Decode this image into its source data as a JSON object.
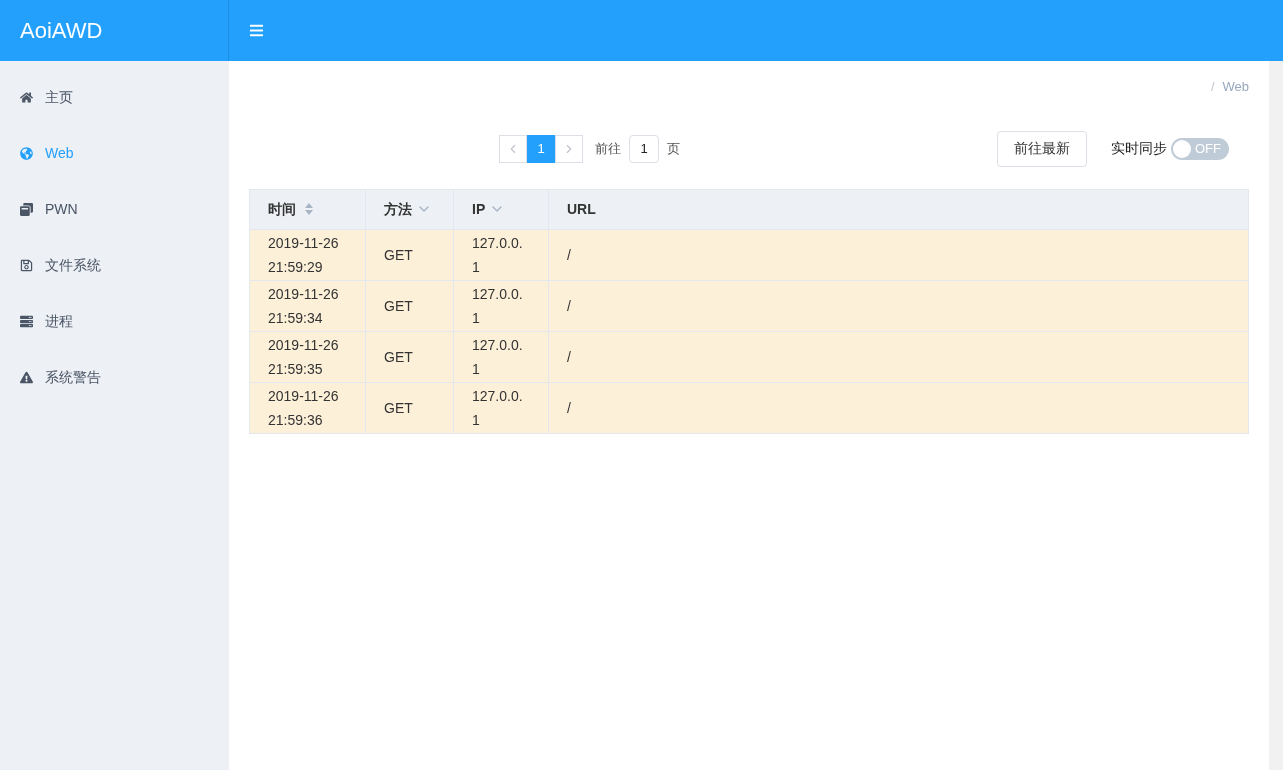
{
  "app": {
    "title": "AoiAWD"
  },
  "sidebar": {
    "items": [
      {
        "label": "主页",
        "kind": "home",
        "selected": false
      },
      {
        "label": "Web",
        "kind": "globe",
        "selected": true
      },
      {
        "label": "PWN",
        "kind": "windows",
        "selected": false
      },
      {
        "label": "文件系统",
        "kind": "save",
        "selected": false
      },
      {
        "label": "进程",
        "kind": "server",
        "selected": false
      },
      {
        "label": "系统警告",
        "kind": "warning",
        "selected": false
      }
    ]
  },
  "breadcrumb": {
    "separator": "/",
    "current": "Web"
  },
  "pagination": {
    "pages": [
      {
        "label": "1",
        "selected": true
      }
    ],
    "goto_label": "前往",
    "goto_value": "1",
    "page_suffix": "页"
  },
  "latest_button": "前往最新",
  "sync": {
    "label": "实时同步",
    "on": false,
    "state_text": "OFF"
  },
  "table": {
    "columns": [
      {
        "label": "时间",
        "kind": "sort"
      },
      {
        "label": "方法",
        "kind": "filter"
      },
      {
        "label": "IP",
        "kind": "filter"
      },
      {
        "label": "URL",
        "kind": "plain"
      }
    ],
    "rows": [
      [
        "2019-11-26 21:59:29",
        "GET",
        "127.0.0.1",
        "/"
      ],
      [
        "2019-11-26 21:59:34",
        "GET",
        "127.0.0.1",
        "/"
      ],
      [
        "2019-11-26 21:59:35",
        "GET",
        "127.0.0.1",
        "/"
      ],
      [
        "2019-11-26 21:59:36",
        "GET",
        "127.0.0.1",
        "/"
      ]
    ]
  }
}
